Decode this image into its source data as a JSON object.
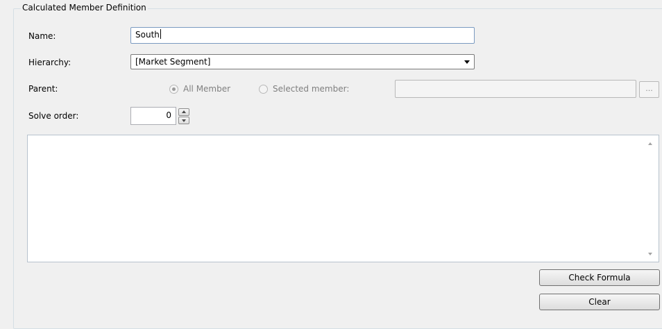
{
  "group": {
    "title": "Calculated Member Definition"
  },
  "name": {
    "label": "Name:",
    "value": "South"
  },
  "hierarchy": {
    "label": "Hierarchy:",
    "selected": "[Market Segment]"
  },
  "parent": {
    "label": "Parent:",
    "option_all": "All Member",
    "option_selected": "Selected member:",
    "selected_member_value": "",
    "browse_label": "..."
  },
  "solve_order": {
    "label": "Solve order:",
    "value": "0"
  },
  "formula": {
    "text": ""
  },
  "buttons": {
    "check_formula": "Check Formula",
    "clear": "Clear"
  },
  "colors": {
    "input_border_focus": "#7a9ac0",
    "disabled_text": "#7f7f7f",
    "window_bg": "#f0f0f0"
  },
  "icons": {
    "spin_up": "triangle-up",
    "spin_down": "triangle-down",
    "combo": "chevron-down",
    "scroll_up": "triangle-up",
    "scroll_down": "triangle-down"
  }
}
